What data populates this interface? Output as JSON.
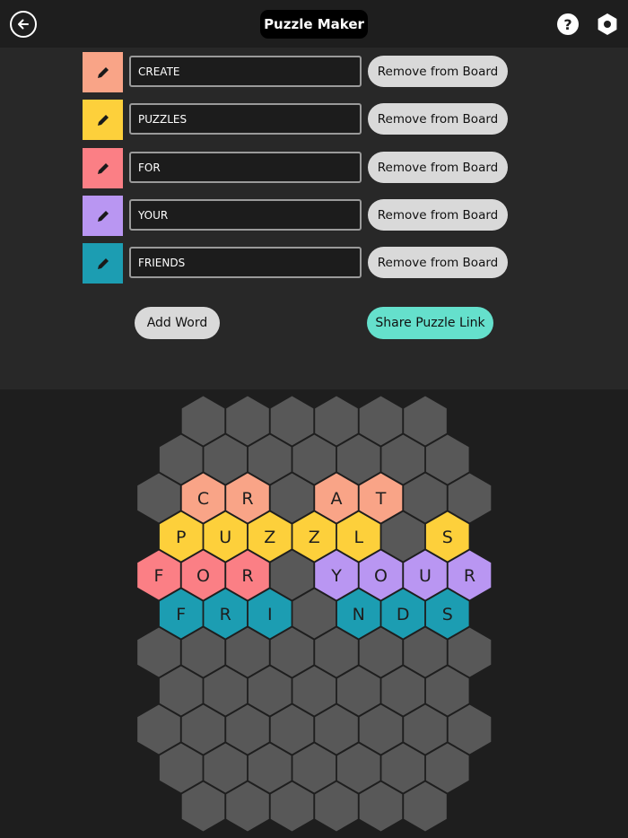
{
  "header": {
    "title": "Puzzle Maker",
    "back_icon": "arrow-left-circle-icon",
    "help_label": "?",
    "settings_icon": "hexagon-gear-icon"
  },
  "words": [
    {
      "value": "CREATE",
      "color": "#f9a487",
      "remove_label": "Remove from Board"
    },
    {
      "value": "PUZZLES",
      "color": "#fdd03b",
      "remove_label": "Remove from Board"
    },
    {
      "value": "FOR",
      "color": "#fb7f85",
      "remove_label": "Remove from Board"
    },
    {
      "value": "YOUR",
      "color": "#b996f2",
      "remove_label": "Remove from Board"
    },
    {
      "value": "FRIENDS",
      "color": "#1c9db2",
      "remove_label": "Remove from Board"
    }
  ],
  "actions": {
    "add_word_label": "Add Word",
    "share_label": "Share Puzzle Link"
  },
  "colors": {
    "empty_cell": "#585858",
    "share_accent": "#65e0cc"
  },
  "board": {
    "rows": [
      "EEEEEE",
      "EEEEEEE",
      "ECREATEE",
      "PUZZLES",
      "FOR#YOUR",
      "FRIENDS",
      "EEEEEEEE",
      "EEEEEEE",
      "EEEEEEEE",
      "EEEEEEE",
      "EEEEEE"
    ],
    "row_colors": [
      null,
      null,
      "#f9a487",
      "#fdd03b",
      null,
      "#1c9db2",
      null,
      null,
      null,
      null,
      null
    ],
    "row4_colors": [
      "#fb7f85",
      "#fb7f85",
      "#fb7f85",
      null,
      "#b996f2",
      "#b996f2",
      "#b996f2",
      "#b996f2"
    ]
  }
}
